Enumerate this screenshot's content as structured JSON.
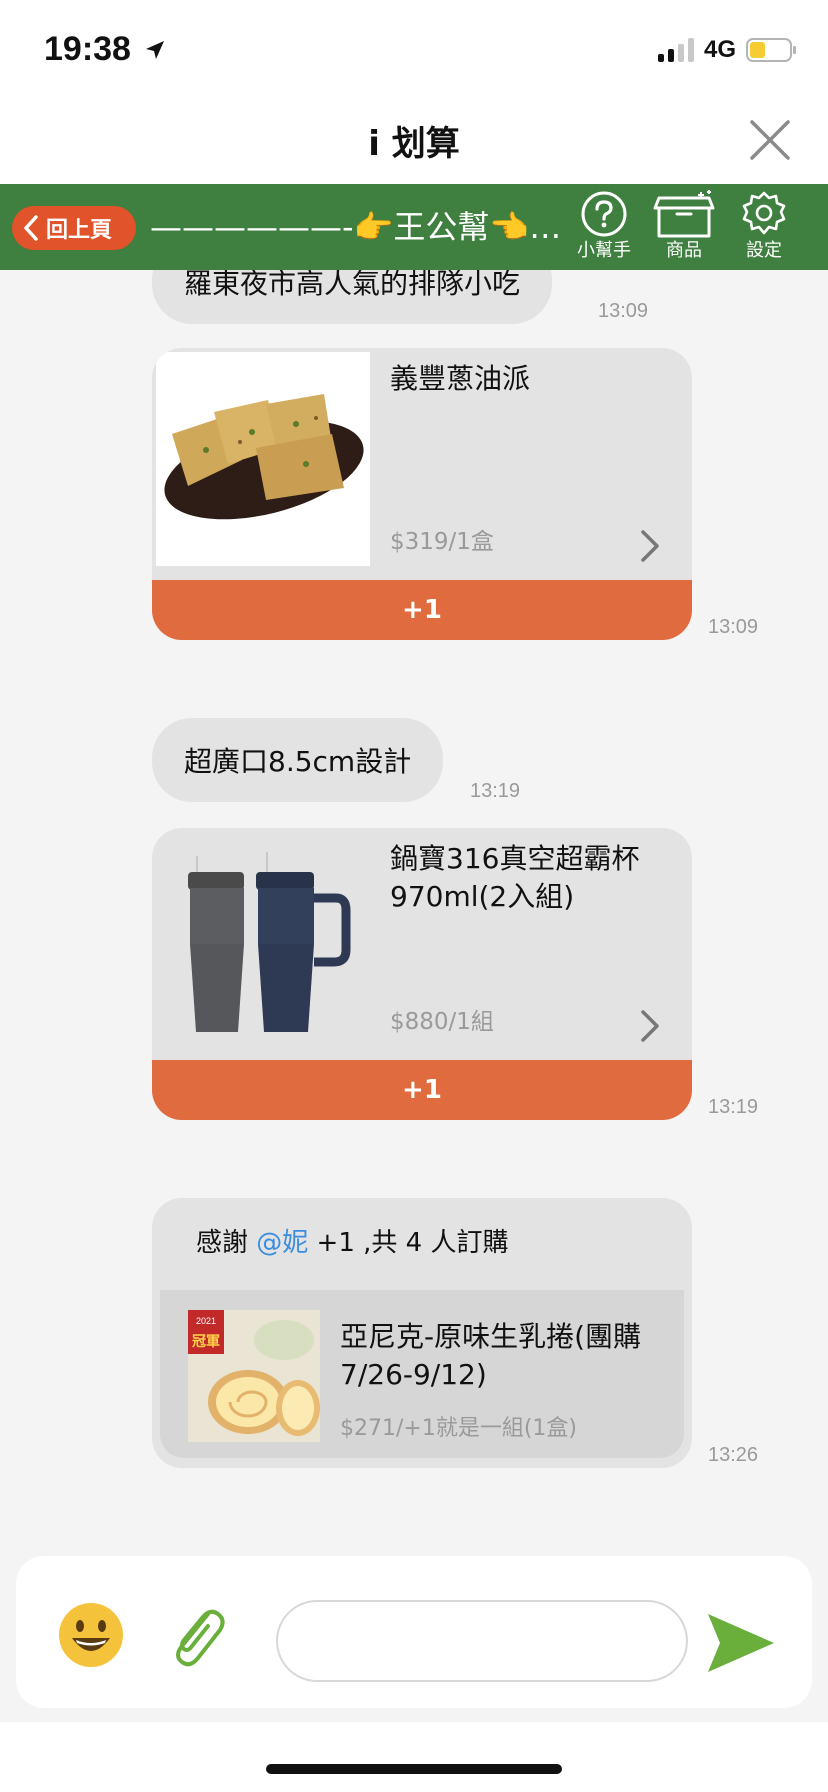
{
  "status_bar": {
    "time": "19:38",
    "network": "4G",
    "battery_level": 0.4
  },
  "title_bar": {
    "title": "i 划算"
  },
  "toolbar": {
    "back_label": "回上頁",
    "banner_text": "——————-👉王公幫👈——————",
    "tools": [
      {
        "icon": "help-icon",
        "label": "小幫手"
      },
      {
        "icon": "box-icon",
        "label": "商品"
      },
      {
        "icon": "gear-icon",
        "label": "設定"
      }
    ]
  },
  "messages": [
    {
      "type": "text",
      "text": "羅東夜市高人氣的排隊小吃",
      "time": "13:09"
    },
    {
      "type": "product",
      "name": "義豐蔥油派",
      "price": "$319/1盒",
      "button": "+1",
      "time": "13:09"
    },
    {
      "type": "text",
      "text": "超廣口8.5cm設計",
      "time": "13:19"
    },
    {
      "type": "product",
      "name": "鍋寶316真空超霸杯970ml(2入組)",
      "price": "$880/1組",
      "button": "+1",
      "time": "13:19"
    },
    {
      "type": "order_notice",
      "prefix": "感謝 ",
      "mention": "@妮",
      "suffix": " +1 ,共 4 人訂購",
      "product_name": "亞尼克-原味生乳捲(團購7/26-9/12)",
      "product_price": "$271/+1就是一組(1盒)",
      "badge_year": "2021",
      "badge_text": "冠軍",
      "time": "13:26"
    }
  ],
  "composer": {
    "placeholder": ""
  },
  "colors": {
    "toolbar_green": "#3f7f3f",
    "back_button": "#e0532b",
    "plus_button": "#e06b3e",
    "mention_blue": "#3b8de0",
    "send_green": "#6aaf3c"
  }
}
